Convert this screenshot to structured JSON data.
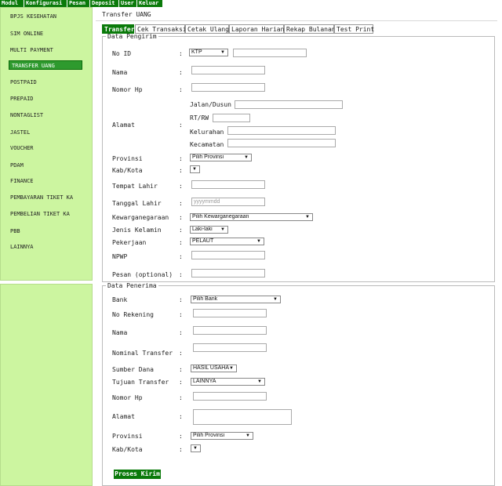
{
  "topmenu": [
    "Modul",
    "Konfigurasi",
    "Pesan",
    "Deposit",
    "User",
    "Keluar"
  ],
  "sidebar": [
    "BPJS KESEHATAN",
    "SIM ONLINE",
    "MULTI PAYMENT",
    "TRANSFER UANG",
    "POSTPAID",
    "PREPAID",
    "NONTAGLIST",
    "JASTEL",
    "VOUCHER",
    "PDAM",
    "FINANCE",
    "PEMBAYARAN TIKET KA",
    "PEMBELIAN TIKET KA",
    "PBB",
    "LAINNYA"
  ],
  "page": {
    "title": "Transfer UANG"
  },
  "tabs": [
    "Transfer",
    "Cek Transaksi",
    "Cetak Ulang",
    "Laporan Harian",
    "Rekap Bulanan",
    "Test Print"
  ],
  "pengirim": {
    "legend": "Data Pengirim",
    "noid_label": "No ID",
    "noid_type": "KTP",
    "nama_label": "Nama",
    "hp_label": "Nomor Hp",
    "alamat_label": "Alamat",
    "jalan_label": "Jalan/Dusun",
    "rtrw_label": "RT/RW",
    "kelurahan_label": "Kelurahan",
    "kecamatan_label": "Kecamatan",
    "provinsi_label": "Provinsi",
    "provinsi_value": "Pilih Provinsi",
    "kab_label": "Kab/Kota",
    "tempat_label": "Tempat Lahir",
    "tanggal_label": "Tanggal Lahir",
    "tanggal_placeholder": "yyyymmdd",
    "kewarga_label": "Kewarganegaraan",
    "kewarga_value": "Pilih Kewarganegaraan",
    "jk_label": "Jenis Kelamin",
    "jk_value": "Laki-laki",
    "pekerjaan_label": "Pekerjaan",
    "pekerjaan_value": "PELAUT",
    "npwp_label": "NPWP",
    "pesan_label": "Pesan (optional)"
  },
  "penerima": {
    "legend": "Data Penerima",
    "bank_label": "Bank",
    "bank_value": "Pilih Bank",
    "norek_label": "No Rekening",
    "nama_label": "Nama",
    "nominal_label": "Nominal Transfer",
    "sumber_label": "Sumber Dana",
    "sumber_value": "HASIL USAHA",
    "tujuan_label": "Tujuan Transfer",
    "tujuan_value": "LAINNYA",
    "hp_label": "Nomor Hp",
    "alamat_label": "Alamat",
    "provinsi_label": "Provinsi",
    "provinsi_value": "Pilih Provinsi",
    "kab_label": "Kab/Kota"
  },
  "submit_label": "Proses Kirim",
  "colors": {
    "menu_green": "#0a7a0a",
    "sidebar_bg": "#ccf5a0",
    "active_item": "#2e9a2e"
  }
}
